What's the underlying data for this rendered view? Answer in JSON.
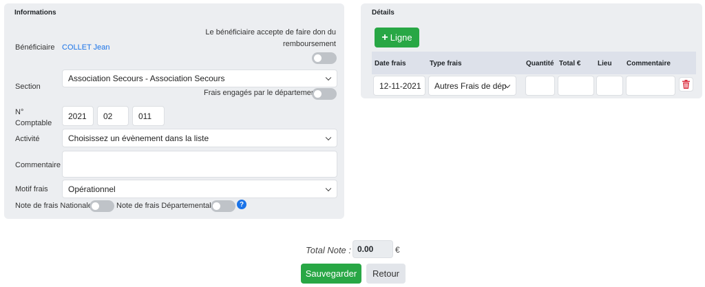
{
  "left": {
    "title": "Informations",
    "beneficiary_label": "Bénéficiaire",
    "beneficiary_value": "COLLET Jean",
    "donation_text": "Le bénéficiaire accepte de faire don du remboursement",
    "section_label": "Section",
    "section_value": "Association Secours - Association Secours",
    "dept_costs_label": "Frais engagés par le département",
    "comptable_label": "N° Comptable",
    "comptable_year": "2021",
    "comptable_month": "02",
    "comptable_number": "011",
    "activity_label": "Activité",
    "activity_value": "Choisissez un évènement dans la liste",
    "comment_label": "Commentaire",
    "comment_value": "",
    "motif_label": "Motif frais",
    "motif_value": "Opérationnel",
    "national_label": "Note de frais Nationale",
    "departmental_label": "Note de frais Départementale",
    "help_glyph": "?"
  },
  "right": {
    "title": "Détails",
    "add_line_label": "Ligne",
    "columns": [
      "Date frais",
      "Type frais",
      "Quantité",
      "Total €",
      "Lieu",
      "Commentaire"
    ],
    "row": {
      "date": "12-11-2021",
      "type": "Autres Frais de dép",
      "quantity": "",
      "total": "",
      "location": "",
      "comment": ""
    },
    "delete_icon": "trash-icon"
  },
  "footer": {
    "total_label": "Total Note :",
    "total_value": "0.00",
    "currency": "€",
    "save_label": "Sauvegarder",
    "back_label": "Retour"
  },
  "colors": {
    "panel_bg": "#eceef1",
    "link": "#1a73e8",
    "success": "#28a745",
    "danger": "#dc3545",
    "toggle_off": "#bfc3c8"
  }
}
